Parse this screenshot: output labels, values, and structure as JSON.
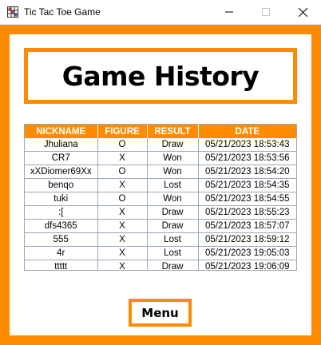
{
  "window": {
    "title": "Tic Tac Toe Game",
    "icons": {
      "app": "tic-tac-toe-grid-icon",
      "minimize": "minimize-icon",
      "maximize": "maximize-icon",
      "close": "close-icon"
    }
  },
  "colors": {
    "accent": "#ff8c00",
    "background": "#ffffff",
    "grid": "#9aa8b8"
  },
  "heading": "Game History",
  "table": {
    "columns": [
      "NICKNAME",
      "FIGURE",
      "RESULT",
      "DATE"
    ],
    "rows": [
      [
        "Jhuliana",
        "O",
        "Draw",
        "05/21/2023 18:53:43"
      ],
      [
        "CR7",
        "X",
        "Won",
        "05/21/2023 18:53:56"
      ],
      [
        "xXDiomer69Xx",
        "O",
        "Won",
        "05/21/2023 18:54:20"
      ],
      [
        "benqo",
        "X",
        "Lost",
        "05/21/2023 18:54:35"
      ],
      [
        "tuki",
        "O",
        "Won",
        "05/21/2023 18:54:55"
      ],
      [
        ":[",
        "X",
        "Draw",
        "05/21/2023 18:55:23"
      ],
      [
        "dfs4365",
        "X",
        "Draw",
        "05/21/2023 18:57:07"
      ],
      [
        "555",
        "X",
        "Lost",
        "05/21/2023 18:59:12"
      ],
      [
        "4r",
        "X",
        "Lost",
        "05/21/2023 19:05:03"
      ],
      [
        "ttttt",
        "X",
        "Draw",
        "05/21/2023 19:06:09"
      ]
    ]
  },
  "menu_button": "Menu"
}
